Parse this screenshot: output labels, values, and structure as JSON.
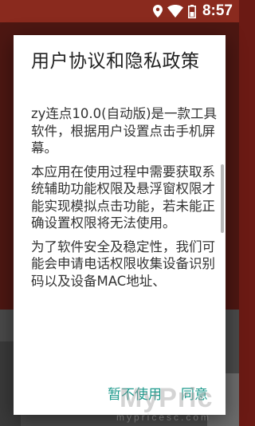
{
  "status_bar": {
    "time": "8:57",
    "icons": [
      "location-icon",
      "wifi-icon",
      "battery-icon"
    ]
  },
  "dialog": {
    "title": "用户协议和隐私政策",
    "paragraphs": [
      "zy连点10.0(自动版)是一款工具软件，根据用户设置点击手机屏幕。",
      "本应用在使用过程中需要获取系统辅助功能权限及悬浮窗权限才能实现模拟点击功能，若未能正确设置权限将无法使用。",
      "为了软件安全及稳定性，我们可能会申请电话权限收集设备识别码以及设备MAC地址、"
    ],
    "actions": {
      "decline": "暂不使用",
      "agree": "同意"
    }
  },
  "watermark": {
    "text": "MyPric",
    "subtext": "mypricesc.com"
  },
  "colors": {
    "status_bar_bg": "#8a2a1e",
    "accent": "#1e9a8c",
    "dialog_bg": "#ffffff"
  }
}
